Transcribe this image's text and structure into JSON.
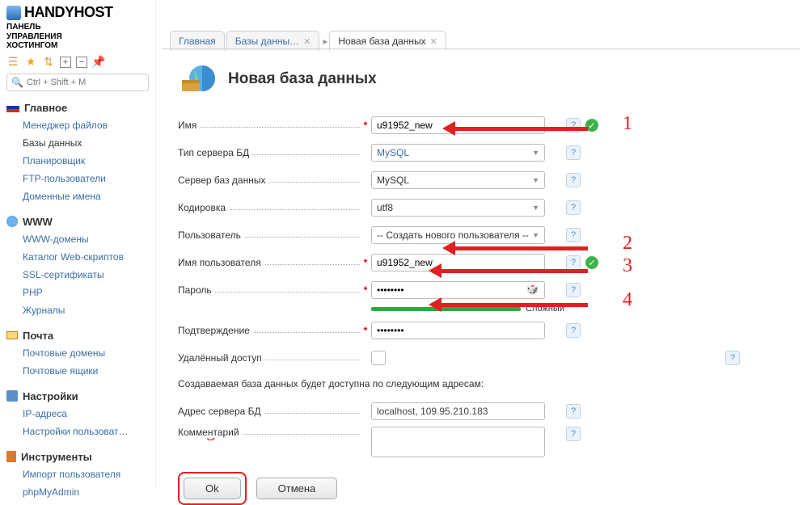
{
  "logo": {
    "name": "HANDYHOST",
    "subtitle1": "ПАНЕЛЬ",
    "subtitle2": "УПРАВЛЕНИЯ",
    "subtitle3": "ХОСТИНГОМ"
  },
  "search": {
    "placeholder": "Ctrl + Shift + M"
  },
  "nav": {
    "main": {
      "title": "Главное",
      "items": [
        "Менеджер файлов",
        "Базы данных",
        "Планировщик",
        "FTP-пользователи",
        "Доменные имена"
      ]
    },
    "www": {
      "title": "WWW",
      "items": [
        "WWW-домены",
        "Каталог Web-скриптов",
        "SSL-сертификаты",
        "PHP",
        "Журналы"
      ]
    },
    "mail": {
      "title": "Почта",
      "items": [
        "Почтовые домены",
        "Почтовые ящики"
      ]
    },
    "settings": {
      "title": "Настройки",
      "items": [
        "IP-адреса",
        "Настройки пользоват…"
      ]
    },
    "tools": {
      "title": "Инструменты",
      "items": [
        "Импорт пользователя",
        "phpMyAdmin"
      ]
    }
  },
  "tabs": {
    "home": "Главная",
    "db": "Базы данны…",
    "new": "Новая база данных"
  },
  "page": {
    "title": "Новая база данных"
  },
  "form": {
    "name": {
      "label": "Имя",
      "value": "u91952_new"
    },
    "dbtype": {
      "label": "Тип сервера БД",
      "value": "MySQL"
    },
    "server": {
      "label": "Сервер баз данных",
      "value": "MySQL"
    },
    "encoding": {
      "label": "Кодировка",
      "value": "utf8"
    },
    "user": {
      "label": "Пользователь",
      "value": "-- Создать нового пользователя --"
    },
    "username": {
      "label": "Имя пользователя",
      "value": "u91952_new"
    },
    "password": {
      "label": "Пароль",
      "strength": "Сложный"
    },
    "confirm": {
      "label": "Подтверждение"
    },
    "remote": {
      "label": "Удалённый доступ"
    },
    "info": "Создаваемая база данных будет доступна по следующим адресам:",
    "address": {
      "label": "Адрес сервера БД",
      "value": "localhost, 109.95.210.183"
    },
    "comment": {
      "label": "Комментарий"
    }
  },
  "buttons": {
    "ok": "Ok",
    "cancel": "Отмена"
  },
  "annotations": [
    "1",
    "2",
    "3",
    "4",
    "5"
  ]
}
